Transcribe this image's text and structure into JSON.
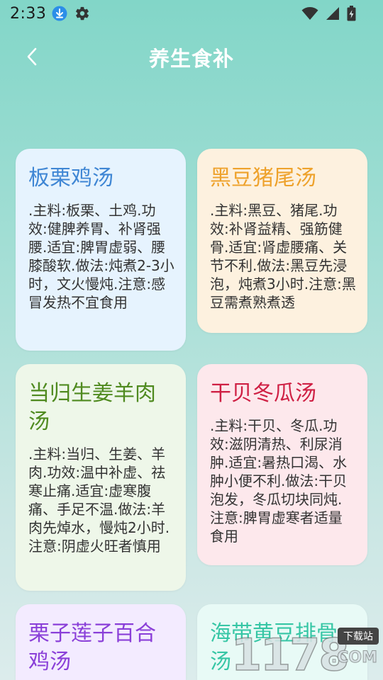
{
  "status_bar": {
    "time": "2:33"
  },
  "header": {
    "title": "养生食补"
  },
  "cards": [
    {
      "title": "板栗鸡汤",
      "body": ".主料:板栗、土鸡.功效:健脾养胃、补肾强腰.适宜:脾胃虚弱、腰膝酸软.做法:炖煮2-3小时，文火慢炖.注意:感冒发热不宜食用",
      "color": "#3f86d4"
    },
    {
      "title": "黑豆猪尾汤",
      "body": ".主料:黑豆、猪尾.功效:补肾益精、强筋健骨.适宜:肾虚腰痛、关节不利.做法:黑豆先浸泡，炖煮3小时.注意:黑豆需煮熟煮透",
      "color": "#eea22c"
    },
    {
      "title": "当归生姜羊肉汤",
      "body": ".主料:当归、生姜、羊肉.功效:温中补虚、祛寒止痛.适宜:虚寒腹痛、手足不温.做法:羊肉先焯水，慢炖2小时.注意:阴虚火旺者慎用",
      "color": "#4f8a1f"
    },
    {
      "title": "干贝冬瓜汤",
      "body": ".主料:干贝、冬瓜.功效:滋阴清热、利尿消肿.适宜:暑热口渴、水肿小便不利.做法:干贝泡发，冬瓜切块同炖.注意:脾胃虚寒者适量食用",
      "color": "#cf2044"
    },
    {
      "title": "栗子莲子百合鸡汤",
      "body": "",
      "color": "#8a3fd8"
    },
    {
      "title": "海带黄豆排骨汤",
      "body": "",
      "color": "#36c6a5"
    }
  ],
  "watermark": {
    "digits": "1178",
    "badge": "下载站",
    "suffix": ".COM"
  },
  "icons": {
    "download": "download-icon",
    "settings": "gear-icon",
    "wifi": "wifi-icon",
    "signal": "signal-icon",
    "battery": "battery-icon",
    "back": "back-arrow-icon"
  }
}
